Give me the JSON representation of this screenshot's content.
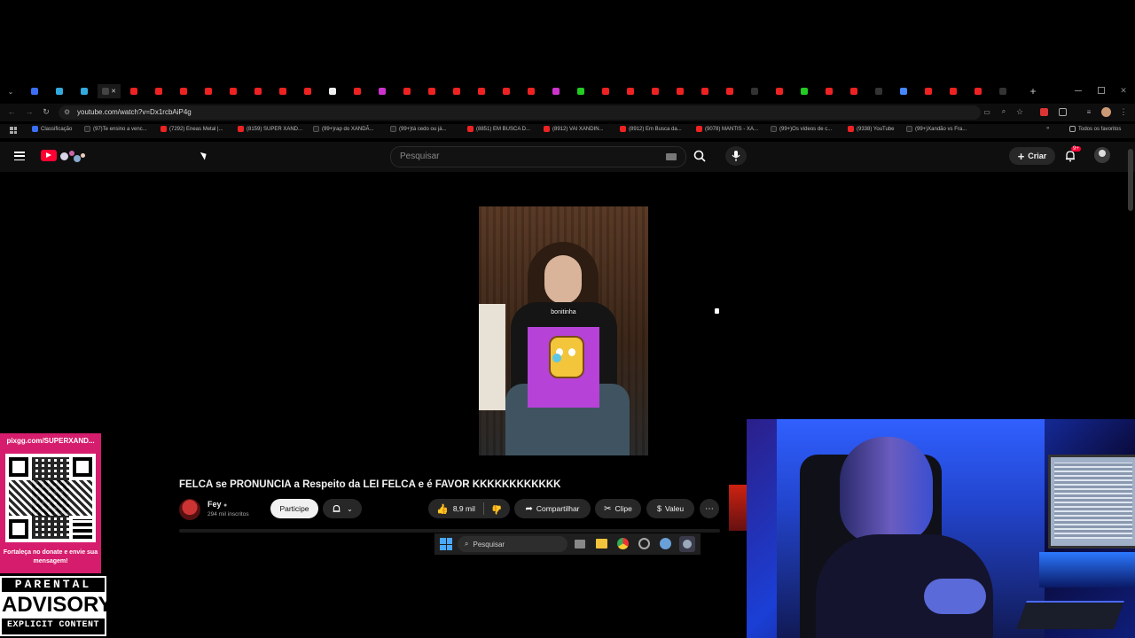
{
  "browser": {
    "url": "youtube.com/watch?v=Dx1rcbAiP4g",
    "new_tab_symbol": "+",
    "tab_close_symbol": "✕",
    "bookmarks": [
      {
        "label": "Classificação",
        "color": "#3b6ef5"
      },
      {
        "label": "(97)Te ensino a venc...",
        "color": "#222"
      },
      {
        "label": "(7292) Eneas Metal |...",
        "color": "#e22"
      },
      {
        "label": "(8159) SUPER XAND...",
        "color": "#e22"
      },
      {
        "label": "(99+)rap do XANDÃ...",
        "color": "#222"
      },
      {
        "label": "(99+)tá cedo ou já...",
        "color": "#222"
      },
      {
        "label": "(8851) EM BUSCA D...",
        "color": "#e22"
      },
      {
        "label": "(8912) VAI XANDIN...",
        "color": "#e22"
      },
      {
        "label": "(8912) Em Busca da...",
        "color": "#e22"
      },
      {
        "label": "(9078) MANTIS - XA...",
        "color": "#e22"
      },
      {
        "label": "(99+)Os vídeos de c...",
        "color": "#222"
      },
      {
        "label": "(9338) YouTube",
        "color": "#e22"
      },
      {
        "label": "(99+)Xandão vs Fra...",
        "color": "#222"
      }
    ],
    "all_bookmarks": "Todos os favoritos"
  },
  "youtube": {
    "search_placeholder": "Pesquisar",
    "create_label": "Criar",
    "notif_badge": "9+",
    "video": {
      "overlay_text": "bonitinha",
      "title": "FELCA se PRONUNCIA a Respeito da LEI FELCA e é FAVOR KKKKKKKKKKKK",
      "channel": "Fey",
      "subscribers": "294 mil inscritos",
      "join_label": "Participe",
      "likes": "8,9 mil",
      "share_label": "Compartilhar",
      "clip_label": "Clipe",
      "thanks_label": "Valeu"
    }
  },
  "stream_overlay": {
    "donate_url": "pixgg.com/SUPERXAND...",
    "donate_message": "Fortaleça no donate e envie sua mensagem!",
    "advisory_line1": "PARENTAL",
    "advisory_line2": "ADVISORY",
    "advisory_line3": "EXPLICIT CONTENT"
  },
  "taskbar": {
    "search_placeholder": "Pesquisar"
  },
  "colors": {
    "youtube_red": "#ff0033",
    "donate_pink": "#d61d6d",
    "webcam_blue": "#1b3fd6"
  }
}
